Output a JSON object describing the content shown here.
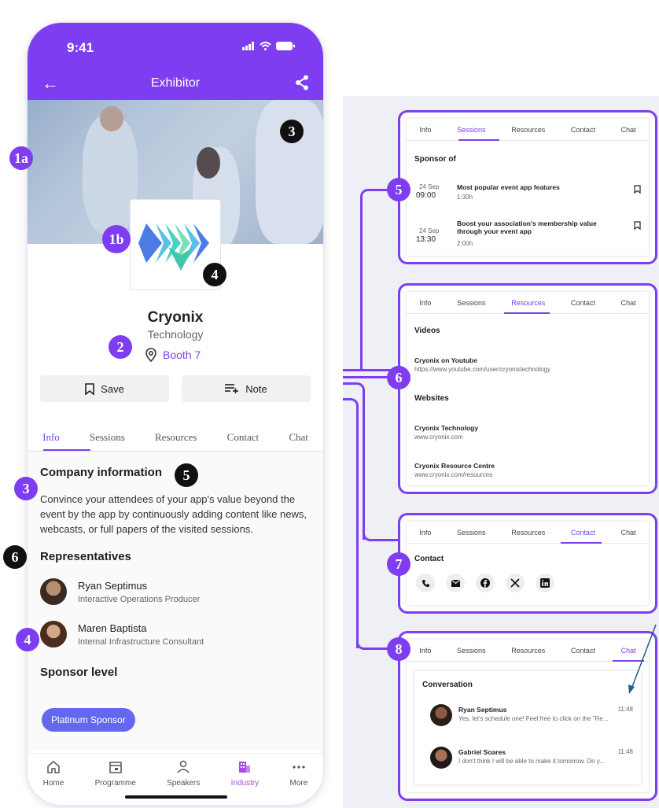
{
  "phone": {
    "status_time": "9:41",
    "nav_title": "Exhibitor",
    "company_name": "Cryonix",
    "company_category": "Technology",
    "booth": "Booth 7",
    "save_label": "Save",
    "note_label": "Note",
    "tabs": [
      "Info",
      "Sessions",
      "Resources",
      "Contact",
      "Chat"
    ],
    "active_tab": "Info",
    "company_info_title": "Company information",
    "company_info_text": "Convince your attendees of your app's value beyond the event by the app by continuously adding content like news, webcasts, or full papers of the visited sessions.",
    "representatives_title": "Representatives",
    "representatives": [
      {
        "name": "Ryan Septimus",
        "title": "Interactive Operations Producer"
      },
      {
        "name": "Maren Baptista",
        "title": "Internal Infrastructure Consultant"
      }
    ],
    "sponsor_level_title": "Sponsor level",
    "sponsor_level": "Platinum Sponsor",
    "bottom_nav": [
      {
        "label": "Home",
        "icon": "home-icon"
      },
      {
        "label": "Programme",
        "icon": "calendar-icon"
      },
      {
        "label": "Speakers",
        "icon": "person-icon"
      },
      {
        "label": "Industry",
        "icon": "building-icon"
      },
      {
        "label": "More",
        "icon": "more-icon"
      }
    ],
    "active_nav": "Industry"
  },
  "markers": {
    "m1a": "1a",
    "m1b": "1b",
    "m2": "2",
    "m3a": "3",
    "m3b": "3",
    "m4a": "4",
    "m4b": "4",
    "m5a": "5",
    "m5b": "5",
    "m6a": "6",
    "m6b": "6",
    "m7": "7",
    "m8": "8"
  },
  "panels": {
    "tabs": [
      "Info",
      "Sessions",
      "Resources",
      "Contact",
      "Chat"
    ],
    "sessions": {
      "title": "Sponsor of",
      "items": [
        {
          "day": "24 Sep",
          "time": "09:00",
          "title": "Most popular event app features",
          "duration": "1:30h"
        },
        {
          "day": "24 Sep",
          "time": "13:30",
          "title": "Boost your association's membership value through your event app",
          "duration": "2:00h"
        }
      ]
    },
    "resources": {
      "videos_title": "Videos",
      "videos": [
        {
          "title": "Cryonix on Youtube",
          "url": "https://www.youtube.com/user/cryonixtechnology"
        }
      ],
      "websites_title": "Websites",
      "websites": [
        {
          "title": "Cryonix Technology",
          "url": "www.cryonix.com"
        },
        {
          "title": "Cryonix Resource Centre",
          "url": "www.cryonix.com/resources"
        }
      ]
    },
    "contact": {
      "title": "Contact"
    },
    "chat": {
      "title": "Conversation",
      "messages": [
        {
          "name": "Ryan Septimus",
          "time": "11:48",
          "text": "Yes, let's schedule one! Feel free to click on the \"Re..."
        },
        {
          "name": "Gabriel Soares",
          "time": "11:48",
          "text": "I don't think I will be able to make it tomorrow. Do y..."
        }
      ]
    }
  },
  "colors": {
    "accent": "#7e3df0",
    "pill": "#6468f0",
    "marker_dark": "#111111"
  }
}
